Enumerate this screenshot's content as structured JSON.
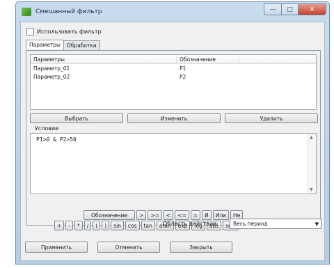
{
  "window": {
    "title": "Смешанный фильтр",
    "controls": {
      "minimize": "—",
      "maximize": "□",
      "close": "✕"
    }
  },
  "use_filter_label": "Использовать фильтр",
  "tabs": [
    {
      "label": "Параметры",
      "active": true
    },
    {
      "label": "Обработка",
      "active": false
    }
  ],
  "params_list": {
    "columns": [
      "Параметры",
      "Обозначение"
    ],
    "rows": [
      {
        "name": "Параметр_01",
        "symbol": "P1"
      },
      {
        "name": "Параметр_02",
        "symbol": "P2"
      }
    ]
  },
  "list_actions": {
    "select": "Выбрать",
    "edit": "Изменить",
    "delete": "Удалить"
  },
  "condition": {
    "label": "Условие",
    "value": "P1>0 & P2>50"
  },
  "operators_row1": [
    "Обозначение",
    ">",
    ">=",
    "<",
    "<=",
    "=",
    "И",
    "Или",
    "Не"
  ],
  "operators_row2": [
    "+",
    "-",
    "*",
    "/",
    "(",
    ")",
    "sin",
    "cos",
    "tan",
    "atan",
    "exp",
    "log",
    "abs",
    "sqrt"
  ],
  "scope": {
    "label": "Область действия:",
    "value": "Весь период"
  },
  "footer": {
    "apply": "Применить",
    "cancel": "Отменить",
    "close": "Закрыть"
  }
}
